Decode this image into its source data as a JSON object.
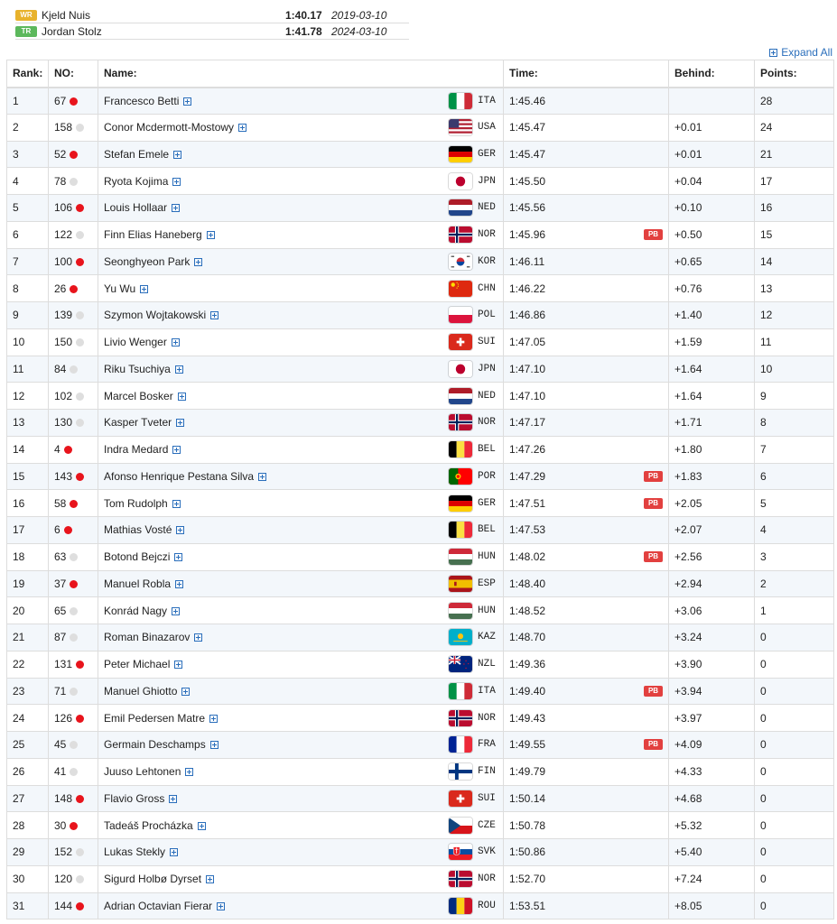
{
  "records": [
    {
      "badge": "WR",
      "color": "#e8b22c",
      "name": "Kjeld Nuis",
      "time": "1:40.17",
      "date": "2019-03-10"
    },
    {
      "badge": "TR",
      "color": "#5cb85c",
      "name": "Jordan Stolz",
      "time": "1:41.78",
      "date": "2024-03-10"
    }
  ],
  "expand_label": "Expand All",
  "headers": {
    "rank": "Rank:",
    "no": "NO:",
    "name": "Name:",
    "time": "Time:",
    "behind": "Behind:",
    "points": "Points:"
  },
  "pb_label": "PB",
  "rows": [
    {
      "rank": "1",
      "no": "67",
      "dot": "red",
      "name": "Francesco Betti",
      "country": "ITA",
      "time": "1:45.46",
      "pb": false,
      "behind": "",
      "points": "28"
    },
    {
      "rank": "2",
      "no": "158",
      "dot": "grey",
      "name": "Conor Mcdermott-Mostowy",
      "country": "USA",
      "time": "1:45.47",
      "pb": false,
      "behind": "+0.01",
      "points": "24"
    },
    {
      "rank": "3",
      "no": "52",
      "dot": "red",
      "name": "Stefan Emele",
      "country": "GER",
      "time": "1:45.47",
      "pb": false,
      "behind": "+0.01",
      "points": "21"
    },
    {
      "rank": "4",
      "no": "78",
      "dot": "grey",
      "name": "Ryota Kojima",
      "country": "JPN",
      "time": "1:45.50",
      "pb": false,
      "behind": "+0.04",
      "points": "17"
    },
    {
      "rank": "5",
      "no": "106",
      "dot": "red",
      "name": "Louis Hollaar",
      "country": "NED",
      "time": "1:45.56",
      "pb": false,
      "behind": "+0.10",
      "points": "16"
    },
    {
      "rank": "6",
      "no": "122",
      "dot": "grey",
      "name": "Finn Elias Haneberg",
      "country": "NOR",
      "time": "1:45.96",
      "pb": true,
      "behind": "+0.50",
      "points": "15"
    },
    {
      "rank": "7",
      "no": "100",
      "dot": "red",
      "name": "Seonghyeon Park",
      "country": "KOR",
      "time": "1:46.11",
      "pb": false,
      "behind": "+0.65",
      "points": "14"
    },
    {
      "rank": "8",
      "no": "26",
      "dot": "red",
      "name": "Yu Wu",
      "country": "CHN",
      "time": "1:46.22",
      "pb": false,
      "behind": "+0.76",
      "points": "13"
    },
    {
      "rank": "9",
      "no": "139",
      "dot": "grey",
      "name": "Szymon Wojtakowski",
      "country": "POL",
      "time": "1:46.86",
      "pb": false,
      "behind": "+1.40",
      "points": "12"
    },
    {
      "rank": "10",
      "no": "150",
      "dot": "grey",
      "name": "Livio Wenger",
      "country": "SUI",
      "time": "1:47.05",
      "pb": false,
      "behind": "+1.59",
      "points": "11"
    },
    {
      "rank": "11",
      "no": "84",
      "dot": "grey",
      "name": "Riku Tsuchiya",
      "country": "JPN",
      "time": "1:47.10",
      "pb": false,
      "behind": "+1.64",
      "points": "10"
    },
    {
      "rank": "12",
      "no": "102",
      "dot": "grey",
      "name": "Marcel Bosker",
      "country": "NED",
      "time": "1:47.10",
      "pb": false,
      "behind": "+1.64",
      "points": "9"
    },
    {
      "rank": "13",
      "no": "130",
      "dot": "grey",
      "name": "Kasper Tveter",
      "country": "NOR",
      "time": "1:47.17",
      "pb": false,
      "behind": "+1.71",
      "points": "8"
    },
    {
      "rank": "14",
      "no": "4",
      "dot": "red",
      "name": "Indra Medard",
      "country": "BEL",
      "time": "1:47.26",
      "pb": false,
      "behind": "+1.80",
      "points": "7"
    },
    {
      "rank": "15",
      "no": "143",
      "dot": "red",
      "name": "Afonso Henrique Pestana Silva",
      "country": "POR",
      "time": "1:47.29",
      "pb": true,
      "behind": "+1.83",
      "points": "6"
    },
    {
      "rank": "16",
      "no": "58",
      "dot": "red",
      "name": "Tom Rudolph",
      "country": "GER",
      "time": "1:47.51",
      "pb": true,
      "behind": "+2.05",
      "points": "5"
    },
    {
      "rank": "17",
      "no": "6",
      "dot": "red",
      "name": "Mathias Vosté",
      "country": "BEL",
      "time": "1:47.53",
      "pb": false,
      "behind": "+2.07",
      "points": "4"
    },
    {
      "rank": "18",
      "no": "63",
      "dot": "grey",
      "name": "Botond Bejczi",
      "country": "HUN",
      "time": "1:48.02",
      "pb": true,
      "behind": "+2.56",
      "points": "3"
    },
    {
      "rank": "19",
      "no": "37",
      "dot": "red",
      "name": "Manuel Robla",
      "country": "ESP",
      "time": "1:48.40",
      "pb": false,
      "behind": "+2.94",
      "points": "2"
    },
    {
      "rank": "20",
      "no": "65",
      "dot": "grey",
      "name": "Konrád Nagy",
      "country": "HUN",
      "time": "1:48.52",
      "pb": false,
      "behind": "+3.06",
      "points": "1"
    },
    {
      "rank": "21",
      "no": "87",
      "dot": "grey",
      "name": "Roman Binazarov",
      "country": "KAZ",
      "time": "1:48.70",
      "pb": false,
      "behind": "+3.24",
      "points": "0"
    },
    {
      "rank": "22",
      "no": "131",
      "dot": "red",
      "name": "Peter Michael",
      "country": "NZL",
      "time": "1:49.36",
      "pb": false,
      "behind": "+3.90",
      "points": "0"
    },
    {
      "rank": "23",
      "no": "71",
      "dot": "grey",
      "name": "Manuel Ghiotto",
      "country": "ITA",
      "time": "1:49.40",
      "pb": true,
      "behind": "+3.94",
      "points": "0"
    },
    {
      "rank": "24",
      "no": "126",
      "dot": "red",
      "name": "Emil Pedersen Matre",
      "country": "NOR",
      "time": "1:49.43",
      "pb": false,
      "behind": "+3.97",
      "points": "0"
    },
    {
      "rank": "25",
      "no": "45",
      "dot": "grey",
      "name": "Germain Deschamps",
      "country": "FRA",
      "time": "1:49.55",
      "pb": true,
      "behind": "+4.09",
      "points": "0"
    },
    {
      "rank": "26",
      "no": "41",
      "dot": "grey",
      "name": "Juuso Lehtonen",
      "country": "FIN",
      "time": "1:49.79",
      "pb": false,
      "behind": "+4.33",
      "points": "0"
    },
    {
      "rank": "27",
      "no": "148",
      "dot": "red",
      "name": "Flavio Gross",
      "country": "SUI",
      "time": "1:50.14",
      "pb": false,
      "behind": "+4.68",
      "points": "0"
    },
    {
      "rank": "28",
      "no": "30",
      "dot": "red",
      "name": "Tadeáš Procházka",
      "country": "CZE",
      "time": "1:50.78",
      "pb": false,
      "behind": "+5.32",
      "points": "0"
    },
    {
      "rank": "29",
      "no": "152",
      "dot": "grey",
      "name": "Lukas Stekly",
      "country": "SVK",
      "time": "1:50.86",
      "pb": false,
      "behind": "+5.40",
      "points": "0"
    },
    {
      "rank": "30",
      "no": "120",
      "dot": "grey",
      "name": "Sigurd Holbø Dyrset",
      "country": "NOR",
      "time": "1:52.70",
      "pb": false,
      "behind": "+7.24",
      "points": "0"
    },
    {
      "rank": "31",
      "no": "144",
      "dot": "red",
      "name": "Adrian Octavian Fierar",
      "country": "ROU",
      "time": "1:53.51",
      "pb": false,
      "behind": "+8.05",
      "points": "0"
    }
  ]
}
